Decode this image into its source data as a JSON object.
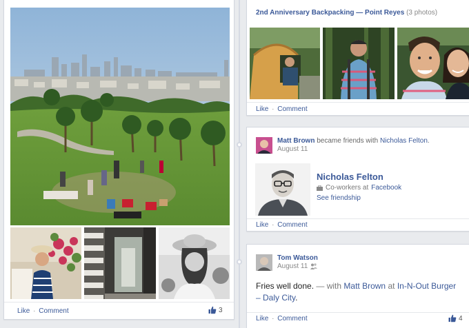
{
  "left_post": {
    "actions": {
      "like": "Like",
      "separator": "·",
      "comment": "Comment"
    },
    "likes_count": "3",
    "icons": {
      "like": "thumbs-up-icon"
    }
  },
  "album_post": {
    "title": "2nd Anniversary Backpacking",
    "title_sep": "—",
    "location": "Point Reyes",
    "photo_count": "(3 photos)",
    "actions": {
      "like": "Like",
      "separator": "·",
      "comment": "Comment"
    }
  },
  "friend_post": {
    "actor": "Matt Brown",
    "verb": "became friends with",
    "friend": "Nicholas Felton",
    "date": "August 11",
    "card": {
      "name": "Nicholas Felton",
      "info_prefix": "Co-workers at",
      "info_company": "Facebook",
      "link": "See friendship"
    },
    "actions": {
      "like": "Like",
      "separator": "·",
      "comment": "Comment"
    },
    "icons": {
      "work": "briefcase-icon"
    }
  },
  "status_post": {
    "actor": "Tom Watson",
    "date": "August 11",
    "text_main": "Fries well done.",
    "text_with": "— with",
    "tagged": "Matt Brown",
    "at": "at",
    "place": "In-N-Out Burger – Daly City",
    "period": ".",
    "actions": {
      "like": "Like",
      "separator": "·",
      "comment": "Comment"
    },
    "likes_count": "4",
    "icons": {
      "audience": "friends-icon",
      "like": "thumbs-up-icon"
    }
  },
  "colors": {
    "link": "#3b5998",
    "background": "#e9ebee"
  }
}
